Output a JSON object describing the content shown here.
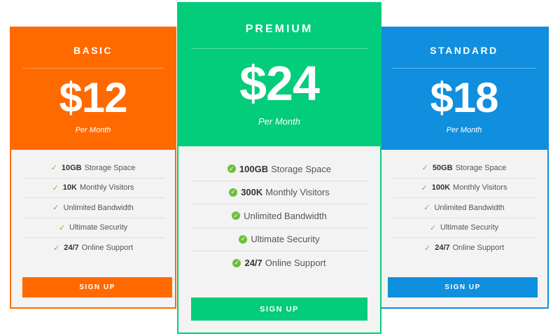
{
  "plans": {
    "basic": {
      "name": "BASIC",
      "price": "$12",
      "period": "Per Month",
      "accent": "#ff6a00",
      "features": [
        {
          "bold": "10GB",
          "text": "Storage Space"
        },
        {
          "bold": "10K",
          "text": "Monthly Visitors"
        },
        {
          "bold": "",
          "text": "Unlimited Bandwidth"
        },
        {
          "bold": "",
          "text": "Ultimate Security"
        },
        {
          "bold": "24/7",
          "text": "Online Support"
        }
      ],
      "button": "SIGN UP"
    },
    "premium": {
      "name": "PREMIUM",
      "price": "$24",
      "period": "Per Month",
      "accent": "#03cc7a",
      "features": [
        {
          "bold": "100GB",
          "text": "Storage Space"
        },
        {
          "bold": "300K",
          "text": "Monthly Visitors"
        },
        {
          "bold": "",
          "text": "Unlimited Bandwidth"
        },
        {
          "bold": "",
          "text": "Ultimate Security"
        },
        {
          "bold": "24/7",
          "text": "Online Support"
        }
      ],
      "button": "SIGN UP"
    },
    "standard": {
      "name": "STANDARD",
      "price": "$18",
      "period": "Per Month",
      "accent": "#0f8fde",
      "features": [
        {
          "bold": "50GB",
          "text": "Storage Space"
        },
        {
          "bold": "100K",
          "text": "Monthly Visitors"
        },
        {
          "bold": "",
          "text": "Unlimited Bandwidth"
        },
        {
          "bold": "",
          "text": "Ultimate Security"
        },
        {
          "bold": "24/7",
          "text": "Online Support"
        }
      ],
      "button": "SIGN UP"
    }
  },
  "icons": {
    "feature_check": "check-icon"
  }
}
